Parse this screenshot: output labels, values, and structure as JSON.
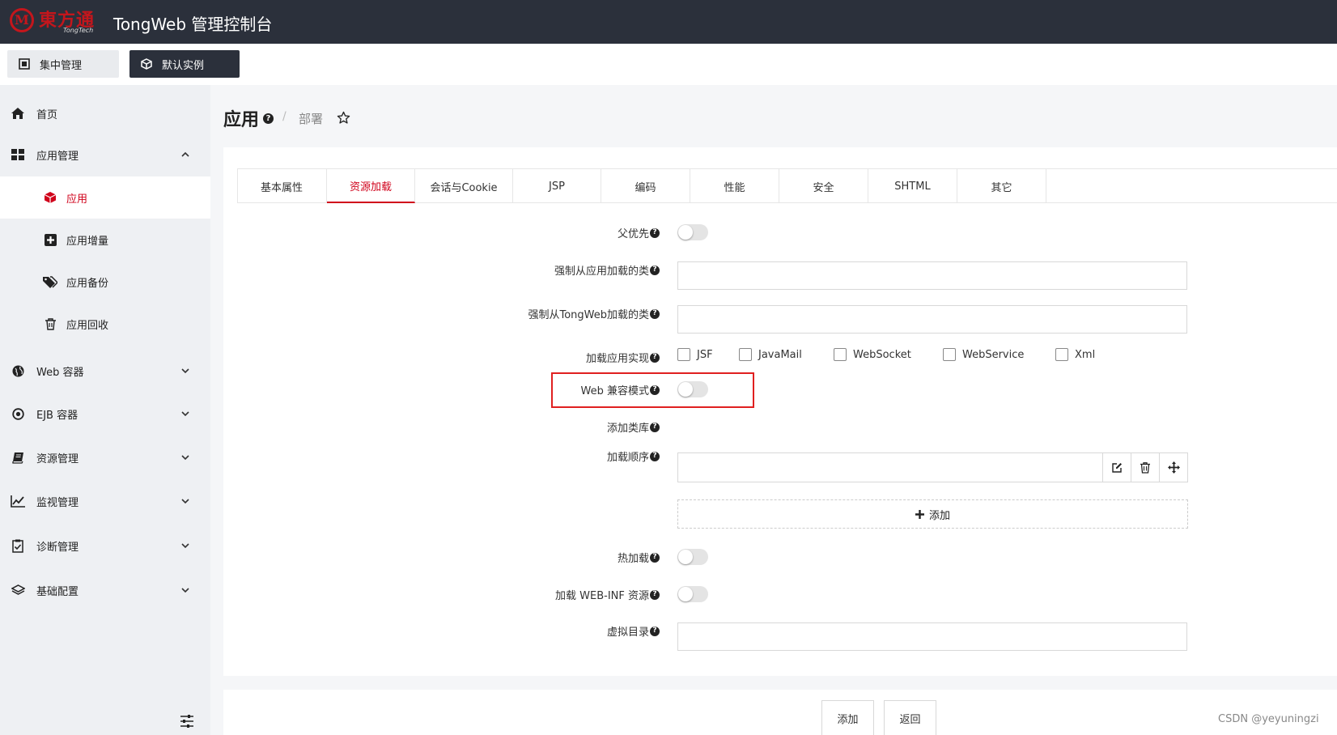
{
  "header": {
    "logo_text": "東方通",
    "logo_sub": "TongTech",
    "app_title": "TongWeb 管理控制台"
  },
  "instance_bar": {
    "central_label": "集中管理",
    "central_icon": "frame-icon",
    "instance_label": "默认实例",
    "instance_icon": "cube-icon"
  },
  "sidebar": {
    "items": [
      {
        "label": "首页",
        "icon": "home-icon"
      },
      {
        "label": "应用管理",
        "icon": "grid-icon",
        "expanded": true
      },
      {
        "label": "应用",
        "icon": "cube-icon",
        "active": true
      },
      {
        "label": "应用增量",
        "icon": "plus-square-icon"
      },
      {
        "label": "应用备份",
        "icon": "tags-icon"
      },
      {
        "label": "应用回收",
        "icon": "trash-icon"
      },
      {
        "label": "Web 容器",
        "icon": "globe-icon"
      },
      {
        "label": "EJB 容器",
        "icon": "dot-circle-icon"
      },
      {
        "label": "资源管理",
        "icon": "book-icon"
      },
      {
        "label": "监视管理",
        "icon": "line-chart-icon"
      },
      {
        "label": "诊断管理",
        "icon": "clipboard-check-icon"
      },
      {
        "label": "基础配置",
        "icon": "layers-icon"
      }
    ]
  },
  "page": {
    "title": "应用",
    "breadcrumb": "部署"
  },
  "tabs": [
    "基本属性",
    "资源加载",
    "会话与Cookie",
    "JSP",
    "编码",
    "性能",
    "安全",
    "SHTML",
    "其它"
  ],
  "active_tab": "资源加载",
  "form": {
    "parent_first": {
      "label": "父优先",
      "on": false
    },
    "force_app_classes": {
      "label": "强制从应用加载的类",
      "value": ""
    },
    "force_tongweb_classes": {
      "label": "强制从TongWeb加载的类",
      "value": ""
    },
    "load_impl": {
      "label": "加载应用实现",
      "options": [
        {
          "label": "JSF",
          "checked": false
        },
        {
          "label": "JavaMail",
          "checked": false
        },
        {
          "label": "WebSocket",
          "checked": false
        },
        {
          "label": "WebService",
          "checked": false
        },
        {
          "label": "Xml",
          "checked": false
        }
      ]
    },
    "web_compat": {
      "label": "Web 兼容模式",
      "on": false
    },
    "add_lib": {
      "label": "添加类库"
    },
    "load_order": {
      "label": "加载顺序",
      "value": "",
      "add_label": "添加"
    },
    "hot_reload": {
      "label": "热加载",
      "on": false
    },
    "load_webinf": {
      "label": "加载 WEB-INF 资源",
      "on": false
    },
    "virtual_dir": {
      "label": "虚拟目录",
      "value": ""
    }
  },
  "footer": {
    "add_label": "添加",
    "back_label": "返回"
  },
  "watermark": "CSDN @yeyuningzi",
  "colors": {
    "topbar": "#2b303b",
    "accent": "#d0021b",
    "highlight_box": "#e02020"
  }
}
